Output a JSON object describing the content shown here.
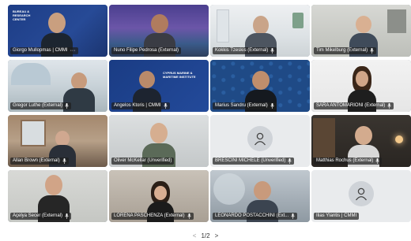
{
  "tiles": [
    {
      "name": "Giorgo Mullopmas | CMMI",
      "more": "···",
      "brand": "BUREAU & RESEARCH CENTER"
    },
    {
      "name": "Nuno Filipe Pedrosa (External)"
    },
    {
      "name": "Kokkis Tzeskis (External)"
    },
    {
      "name": "Tim Mikelburg (External)"
    },
    {
      "name": "Gregor Luthe (External)"
    },
    {
      "name": "Angelos Ktoris | CMMI",
      "brand": "CYPRUS MARINE & MARITIME INSTITUTE"
    },
    {
      "name": "Marius Sandru (External)"
    },
    {
      "name": "SARA ANTOMARIONI (External)"
    },
    {
      "name": "Allan Brown (External)"
    },
    {
      "name": "Oliver McKellar (Unverified)"
    },
    {
      "name": "BRESCINI MICHELE (Unverified)"
    },
    {
      "name": "Matthias Rochus (External)"
    },
    {
      "name": "Açelya Secer (External)"
    },
    {
      "name": "LORENA PASCHENZA (External)"
    },
    {
      "name": "LEONARDO POSTACCHINI (Ext..."
    },
    {
      "name": "Ilias Ylantis | CMMI"
    }
  ],
  "pager": {
    "prev": "<",
    "label": "1/2",
    "next": ">"
  }
}
